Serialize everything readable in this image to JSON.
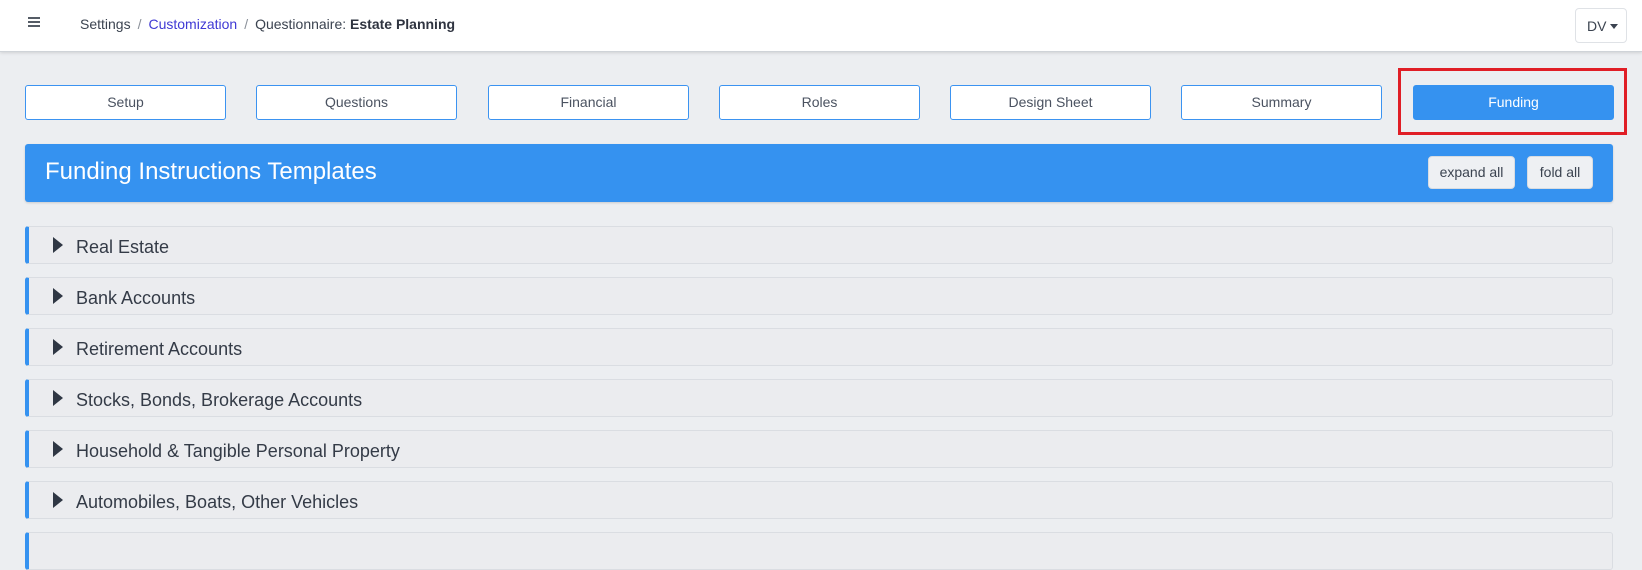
{
  "header": {
    "menu_icon": "hamburger-icon",
    "breadcrumb": {
      "item1": "Settings",
      "separator": "/",
      "item2": "Customization",
      "item3_prefix": "Questionnaire:",
      "item3_bold": "Estate Planning"
    },
    "user_initials": "DV"
  },
  "tabs": [
    "Setup",
    "Questions",
    "Financial",
    "Roles",
    "Design Sheet",
    "Summary",
    "Funding"
  ],
  "active_tab": "Funding",
  "banner": {
    "title": "Funding Instructions Templates",
    "expand_label": "expand all",
    "fold_label": "fold all"
  },
  "sections": [
    "Real Estate",
    "Bank Accounts",
    "Retirement Accounts",
    "Stocks, Bonds, Brokerage Accounts",
    "Household & Tangible Personal Property",
    "Automobiles, Boats, Other Vehicles",
    ""
  ],
  "colors": {
    "accent": "#3592f0",
    "highlight": "#e01e26",
    "background": "#eceef1"
  }
}
